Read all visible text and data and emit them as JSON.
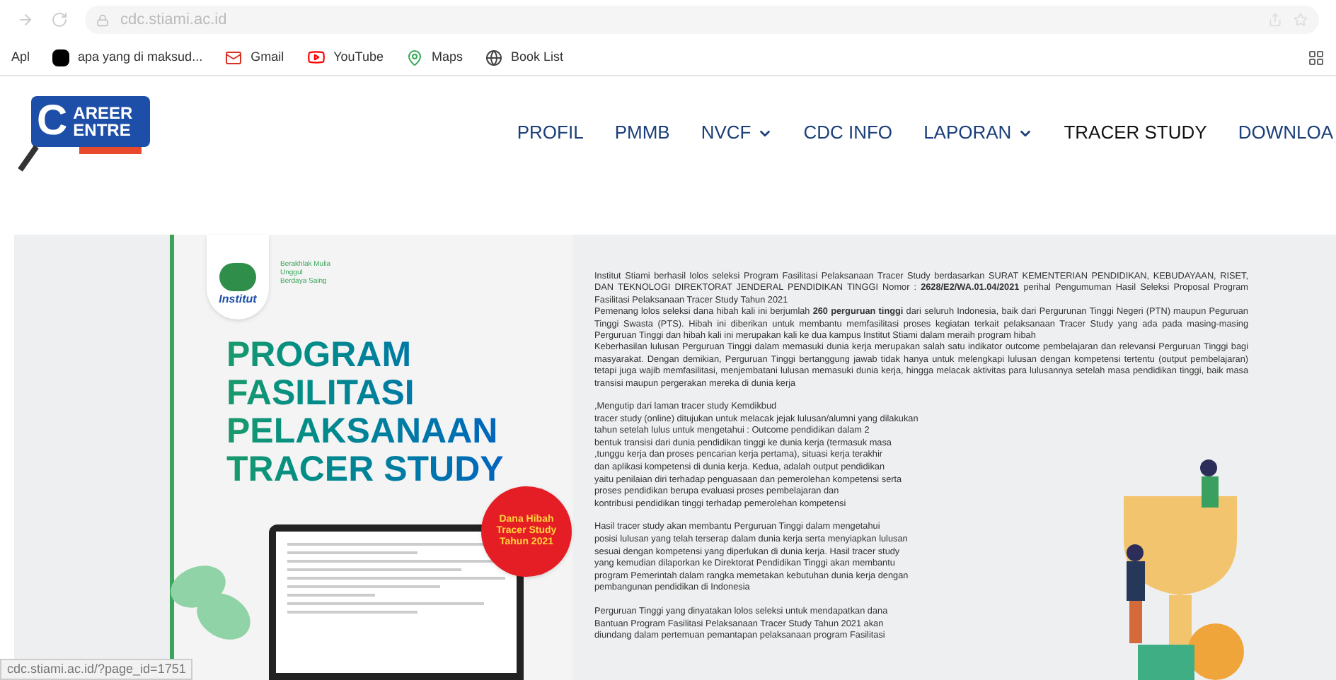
{
  "browser": {
    "url": "cdc.stiami.ac.id",
    "bookmarks": [
      {
        "label": "Apl",
        "kind": "apps"
      },
      {
        "label": "apa yang di maksud...",
        "kind": "page"
      },
      {
        "label": "Gmail",
        "kind": "gmail"
      },
      {
        "label": "YouTube",
        "kind": "youtube"
      },
      {
        "label": "Maps",
        "kind": "maps"
      },
      {
        "label": "Book List",
        "kind": "globe"
      }
    ],
    "status_url": "cdc.stiami.ac.id/?page_id=1751"
  },
  "site_header": {
    "logo": {
      "letter": "C",
      "line1": "AREER",
      "line2": "ENTRE"
    },
    "menu": [
      {
        "label": "PROFIL",
        "dropdown": false,
        "selected": false
      },
      {
        "label": "PMMB",
        "dropdown": false,
        "selected": false
      },
      {
        "label": "NVCF",
        "dropdown": true,
        "selected": false
      },
      {
        "label": "CDC INFO",
        "dropdown": false,
        "selected": false
      },
      {
        "label": "LAPORAN",
        "dropdown": true,
        "selected": false
      },
      {
        "label": "TRACER STUDY",
        "dropdown": false,
        "selected": true
      },
      {
        "label": "DOWNLOA",
        "dropdown": false,
        "selected": false
      }
    ]
  },
  "banner": {
    "institute_logo": "Institut",
    "tagline": [
      "Berakhlak Mulia",
      "Unggul",
      "Berdaya Saing"
    ],
    "title_lines": [
      "PROGRAM",
      "FASILITASI",
      "PELAKSANAAN",
      "TRACER STUDY"
    ],
    "badge_lines": [
      "Dana Hibah",
      "Tracer Study",
      "Tahun 2021"
    ],
    "intro_paragraphs": [
      "Institut Stiami berhasil lolos seleksi Program Fasilitasi Pelaksanaan Tracer Study berdasarkan SURAT KEMENTERIAN PENDIDIKAN, KEBUDAYAAN, RISET, DAN TEKNOLOGI DIREKTORAT JENDERAL PENDIDIKAN TINGGI Nomor : **2628/E2/WA.01.04/2021** perihal Pengumuman Hasil Seleksi Proposal Program Fasilitasi Pelaksanaan Tracer Study Tahun 2021",
      "Pemenang lolos seleksi dana hibah kali ini berjumlah **260 perguruan tinggi** dari seluruh Indonesia, baik dari Pergurunan Tinggi Negeri (PTN) maupun Peguruan Tinggi Swasta (PTS). Hibah ini diberikan untuk membantu memfasilitasi proses kegiatan terkait pelaksanaan Tracer Study yang ada pada masing-masing Perguruan Tinggi dan hibah kali ini merupakan kali ke dua  kampus Institut Stiami dalam meraih program hibah",
      "Keberhasilan lulusan Perguruan Tinggi dalam memasuki dunia kerja merupakan salah satu indikator outcome pembelajaran dan relevansi Perguruan Tinggi bagi masyarakat. Dengan demikian, Perguruan Tinggi bertanggung jawab tidak hanya untuk melengkapi lulusan dengan kompetensi tertentu (output pembelajaran) tetapi juga wajib memfasilitasi, menjembatani lulusan memasuki dunia kerja, hingga melacak aktivitas para lulusannya setelah masa pendidikan tinggi, baik masa transisi maupun pergerakan mereka di dunia kerja"
    ],
    "paragraphs": [
      [
        ",Mengutip dari laman tracer study Kemdikbud",
        "tracer study (online) ditujukan untuk melacak jejak lulusan/alumni yang dilakukan",
        "tahun setelah lulus untuk mengetahui : Outcome pendidikan dalam 2",
        "bentuk transisi dari dunia pendidikan tinggi ke dunia kerja (termasuk masa",
        ",tunggu kerja dan proses pencarian kerja pertama), situasi kerja terakhir",
        "dan aplikasi kompetensi di dunia kerja. Kedua, adalah output pendidikan",
        "yaitu penilaian diri terhadap penguasaan dan pemerolehan kompetensi serta",
        "proses pendidikan berupa evaluasi proses pembelajaran dan",
        "kontribusi pendidikan tinggi terhadap pemerolehan kompetensi"
      ],
      [
        "Hasil tracer study akan membantu Perguruan Tinggi dalam mengetahui",
        "posisi lulusan yang telah terserap dalam dunia kerja serta menyiapkan lulusan",
        "sesuai dengan kompetensi yang diperlukan di dunia kerja. Hasil tracer study",
        "yang kemudian dilaporkan ke Direktorat Pendidikan Tinggi akan membantu",
        "program Pemerintah dalam rangka memetakan kebutuhan dunia kerja dengan",
        "pembangunan pendidikan di Indonesia"
      ],
      [
        "Perguruan Tinggi yang dinyatakan lolos seleksi untuk mendapatkan dana",
        "Bantuan Program Fasilitasi Pelaksanaan Tracer Study Tahun 2021 akan",
        "diundang dalam pertemuan pemantapan pelaksanaan program Fasilitasi"
      ]
    ]
  }
}
